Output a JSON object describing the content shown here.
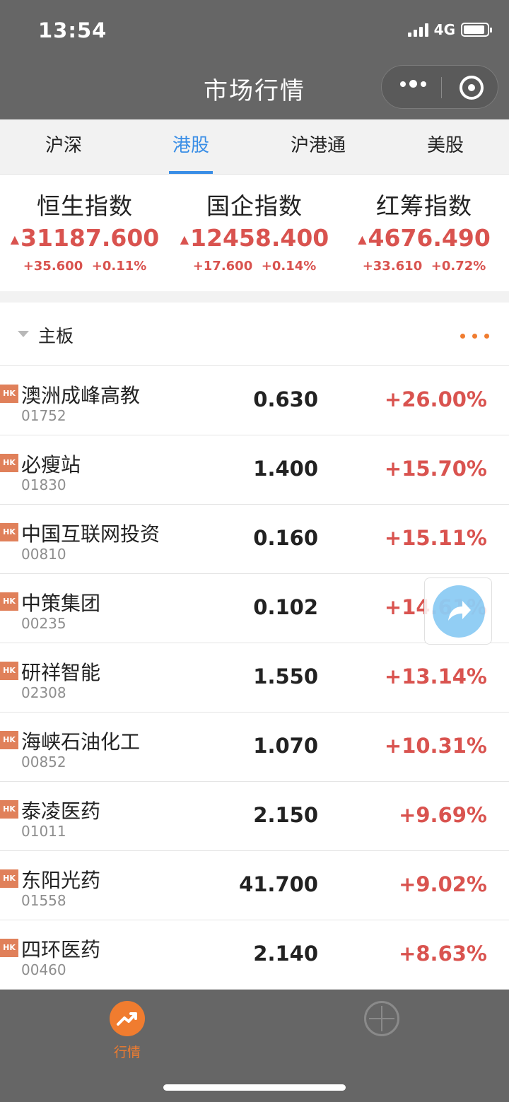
{
  "status_bar": {
    "time": "13:54",
    "network": "4G",
    "battery_level": 0.9
  },
  "nav": {
    "title": "市场行情"
  },
  "tabs": [
    {
      "label": "沪深",
      "active": false
    },
    {
      "label": "港股",
      "active": true
    },
    {
      "label": "沪港通",
      "active": false
    },
    {
      "label": "美股",
      "active": false
    }
  ],
  "indices": [
    {
      "name": "恒生指数",
      "value": "31187.600",
      "change": "+35.600",
      "percent": "+0.11%"
    },
    {
      "name": "国企指数",
      "value": "12458.400",
      "change": "+17.600",
      "percent": "+0.14%"
    },
    {
      "name": "红筹指数",
      "value": "4676.490",
      "change": "+33.610",
      "percent": "+0.72%"
    }
  ],
  "section": {
    "label": "主板"
  },
  "market_badge": "HK",
  "stocks": [
    {
      "name": "澳洲成峰高教",
      "code": "01752",
      "price": "0.630",
      "change": "+26.00%"
    },
    {
      "name": "必瘦站",
      "code": "01830",
      "price": "1.400",
      "change": "+15.70%"
    },
    {
      "name": "中国互联网投资",
      "code": "00810",
      "price": "0.160",
      "change": "+15.11%"
    },
    {
      "name": "中策集团",
      "code": "00235",
      "price": "0.102",
      "change": "+14.61%"
    },
    {
      "name": "研祥智能",
      "code": "02308",
      "price": "1.550",
      "change": "+13.14%"
    },
    {
      "name": "海峡石油化工",
      "code": "00852",
      "price": "1.070",
      "change": "+10.31%"
    },
    {
      "name": "泰凌医药",
      "code": "01011",
      "price": "2.150",
      "change": "+9.69%"
    },
    {
      "name": "东阳光药",
      "code": "01558",
      "price": "41.700",
      "change": "+9.02%"
    },
    {
      "name": "四环医药",
      "code": "00460",
      "price": "2.140",
      "change": "+8.63%"
    }
  ],
  "bottom_tabs": [
    {
      "label": "行情",
      "icon": "trend-up-icon",
      "active": true
    },
    {
      "label": "",
      "icon": "add-circle-icon",
      "active": false
    }
  ],
  "colors": {
    "up": "#d9534f",
    "accent": "#3a8ee6",
    "brand": "#f07c2f"
  }
}
